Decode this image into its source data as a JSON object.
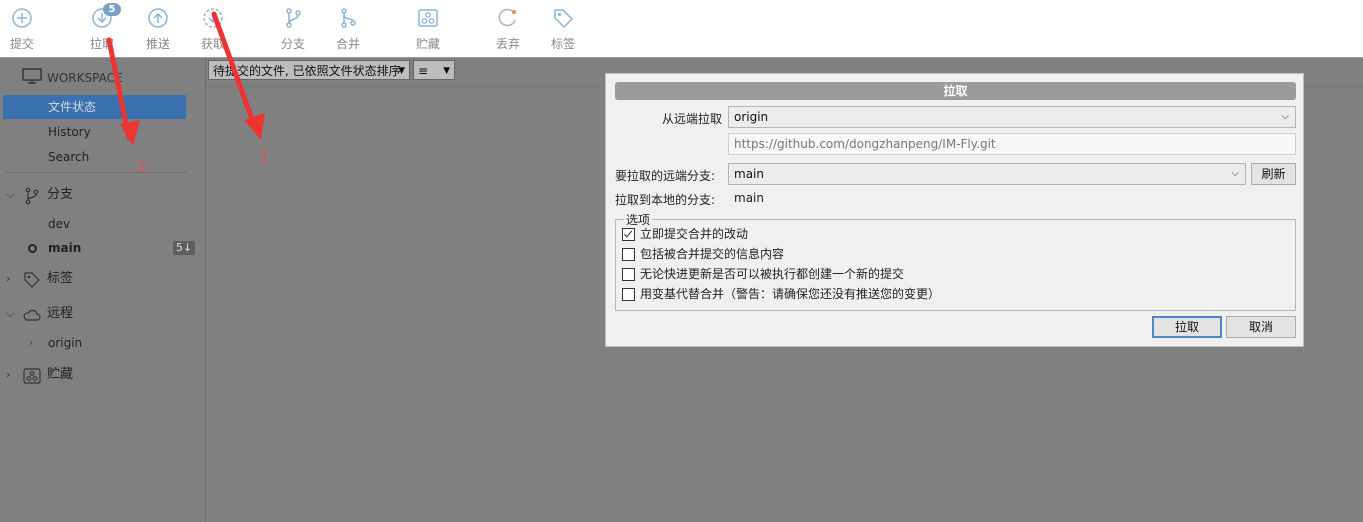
{
  "toolbar": {
    "commit": "提交",
    "pull": "拉取",
    "pull_badge": "5",
    "push": "推送",
    "fetch": "获取",
    "branch": "分支",
    "merge": "合并",
    "stash": "贮藏",
    "discard": "丢弃",
    "tag": "标签"
  },
  "sidebar": {
    "workspace": "WORKSPACE",
    "items": [
      "文件状态",
      "History",
      "Search"
    ],
    "branches": {
      "title": "分支",
      "items": [
        "dev",
        "main"
      ],
      "main_badge": "5↓"
    },
    "tags": {
      "title": "标签"
    },
    "remotes": {
      "title": "远程",
      "items": [
        "origin"
      ]
    },
    "stashes": {
      "title": "贮藏"
    }
  },
  "filterbar": {
    "sort": "待提交的文件, 已依照文件状态排序",
    "view": "≡"
  },
  "annotations": {
    "one": "1",
    "two": "2"
  },
  "dialog": {
    "title": "拉取",
    "remote_label": "从远端拉取",
    "remote_value": "origin",
    "url": "https://github.com/dongzhanpeng/IM-Fly.git",
    "remote_branch_label": "要拉取的远端分支:",
    "remote_branch_value": "main",
    "refresh": "刷新",
    "local_branch_label": "拉取到本地的分支:",
    "local_branch_value": "main",
    "options_title": "选项",
    "options": [
      {
        "label": "立即提交合并的改动",
        "checked": true
      },
      {
        "label": "包括被合并提交的信息内容",
        "checked": false
      },
      {
        "label": "无论快进更新是否可以被执行都创建一个新的提交",
        "checked": false
      },
      {
        "label": "用变基代替合并（警告：请确保您还没有推送您的变更）",
        "checked": false
      }
    ],
    "ok": "拉取",
    "cancel": "取消"
  },
  "colors": {
    "selection": "#3a6fb0",
    "primary_border": "#4a86c8",
    "arrow": "#ee3333"
  }
}
